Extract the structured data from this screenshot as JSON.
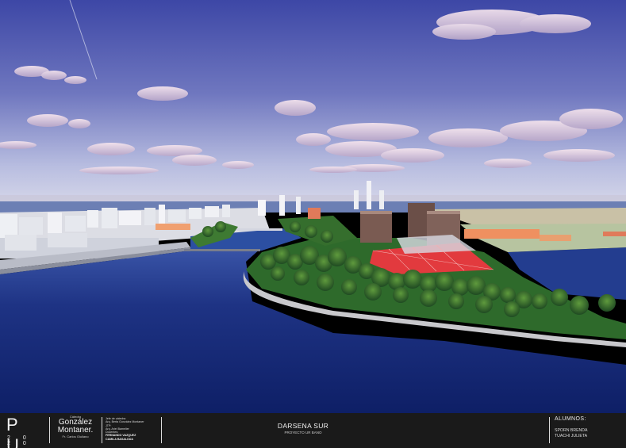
{
  "scene": {
    "description_colors": {
      "sky_top": "#3f4aa8",
      "sky_horizon": "#c9cde6",
      "water": "#1c2f7a",
      "park": "#2f6a2a",
      "greenhouse": "#e0343c",
      "towers": "#7b5d52"
    }
  },
  "footer": {
    "logo_letters": "P U",
    "logo_year": "2 0 2 0",
    "catedra_label": "Cátedra",
    "catedra_name_1": "González",
    "catedra_name_2": "Montaner.",
    "catedra_sub": "Fr. Carlos Giuliano",
    "staff_lines": [
      "Jefe de cátedra:",
      "Arq. Berta González Montaner",
      "JTP:",
      "Arq. Ariel Bamelier",
      "Docentes:",
      "FERNANDO VAZQUEZ",
      "CAMILA BASALDÚA"
    ],
    "project_title": "DARSENA SUR",
    "project_subtitle": "PROYECTO UR BANO",
    "students_heading": "ALUMNOS:",
    "students": [
      "SPORN BRENDA",
      "TUACHI JULIETA"
    ]
  }
}
